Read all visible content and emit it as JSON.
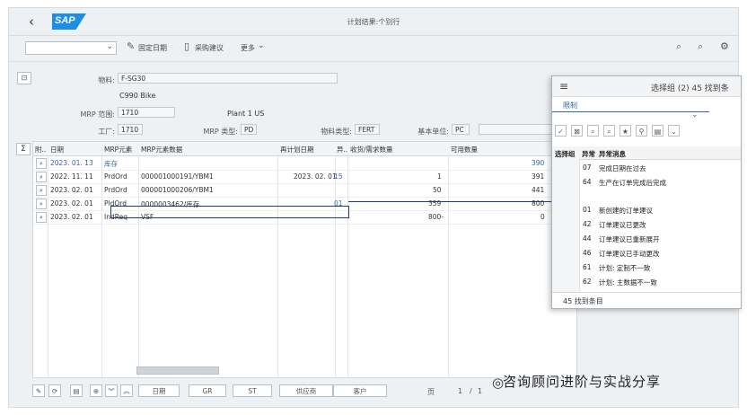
{
  "shell": {
    "back": "‹",
    "logo": "SAP",
    "title": "计划结果:个别行"
  },
  "toolbar": {
    "fixed_date": "固定日期",
    "purchase_proposal": "采购建议",
    "more": "更多"
  },
  "header": {
    "material_label": "物料:",
    "material": "F-SG30",
    "material_desc": "C990 Bike",
    "mrp_area_label": "MRP 范围:",
    "mrp_area": "1710",
    "plant_desc": "Plant 1 US",
    "plant_label": "工厂:",
    "plant": "1710",
    "mrp_type_label": "MRP 类型:",
    "mrp_type": "PD",
    "mat_type_label": "物料类型:",
    "mat_type": "FERT",
    "uom_label": "基本单位:",
    "uom": "PC"
  },
  "table": {
    "headers": [
      "附..",
      "日期",
      "MRP元素",
      "MRP元素数据",
      "再计划日期",
      "异..",
      "收货/需求数量",
      "可用数量"
    ],
    "rows": [
      {
        "date": "2023. 01. 13",
        "elem": "库存",
        "data": "",
        "resched": "",
        "exc": "",
        "qty": "",
        "avail": "390",
        "highlight": true
      },
      {
        "date": "2022. 11. 11",
        "elem": "PrdOrd",
        "data": "000001000191/YBM1",
        "resched": "2023. 02. 01",
        "exc": "15",
        "qty": "1",
        "avail": "391"
      },
      {
        "date": "2023. 02. 01",
        "elem": "PrdOrd",
        "data": "000001000206/YBM1",
        "resched": "",
        "exc": "",
        "qty": "50",
        "avail": "441"
      },
      {
        "date": "2023. 02. 01",
        "elem": "PldOrd",
        "data": "0000003462/库存",
        "resched": "",
        "exc": "01",
        "qty": "359",
        "avail": "800"
      },
      {
        "date": "2023. 02. 01",
        "elem": "IndReq",
        "data": "VSF",
        "resched": "",
        "exc": "",
        "qty": "800-",
        "avail": "0"
      }
    ]
  },
  "bottom": {
    "date_btn": "日期",
    "gr_btn": "GR",
    "st_btn": "ST",
    "vendor_btn": "供应商",
    "customer_btn": "客户",
    "page_label": "页",
    "page": "1",
    "page_sep": "/",
    "page_total": "1",
    "watermark": "咨询顾问进阶与实战分享"
  },
  "popup": {
    "title": "选择组 (2)  45 找到条",
    "tab": "限制",
    "col1": "选择组",
    "col2": "异常",
    "col3": "异常消息",
    "rows": [
      {
        "code": "07",
        "text": "完成日期在过去"
      },
      {
        "code": "64",
        "text": "生产在订单完成后完成"
      },
      {
        "code": "",
        "text": ""
      },
      {
        "code": "01",
        "text": "新创建的订单建议"
      },
      {
        "code": "42",
        "text": "订单建议已更改"
      },
      {
        "code": "44",
        "text": "订单建议已重新展开"
      },
      {
        "code": "46",
        "text": "订单建议已手动更改"
      },
      {
        "code": "61",
        "text": "计划: 定制不一致"
      },
      {
        "code": "62",
        "text": "计划: 主数据不一致"
      }
    ],
    "footer": "45 找到条目"
  },
  "icons": [
    "back-icon",
    "search-icon",
    "settings-icon",
    "menu-icon",
    "magnifier-icon"
  ]
}
